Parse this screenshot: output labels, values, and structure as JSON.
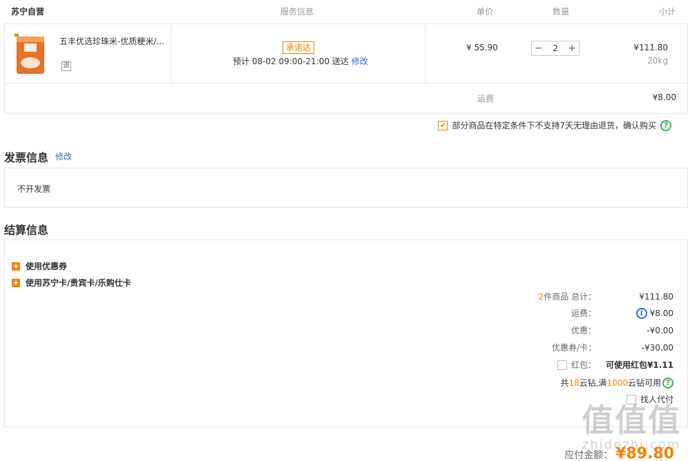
{
  "order_header": {
    "shop": "苏宁自营",
    "service": "服务信息",
    "unit_price": "单价",
    "quantity": "数量",
    "subtotal": "小计"
  },
  "item": {
    "name": "五丰优选珍珠米-优质粳米/...",
    "return_badge": "退",
    "promise_badge": "承诺达",
    "delivery_text": "预计 08-02 09:00-21:00 送达",
    "edit": "修改",
    "price": "¥ 55.90",
    "qty_minus": "−",
    "qty": "2",
    "qty_plus": "+",
    "subtotal": "¥111.80",
    "weight": "20kg"
  },
  "freight": {
    "label": "运费",
    "value": "¥8.00"
  },
  "agree": {
    "text": "部分商品在特定条件下不支持7天无理由退货，确认购买"
  },
  "invoice": {
    "title": "发票信息",
    "edit": "修改",
    "value": "不开发票"
  },
  "settlement": {
    "title": "结算信息",
    "options": [
      "使用优惠券",
      "使用苏宁卡/贵宾卡/乐购仕卡"
    ],
    "summary": {
      "items_count": "2",
      "items_label": "件商品 总计：",
      "items_total": "¥111.80",
      "freight_label": "运费：",
      "freight_value": "¥8.00",
      "discount_label": "优惠：",
      "discount_value": "-¥0.00",
      "coupon_label": "优惠券/卡：",
      "coupon_value": "-¥30.00",
      "redpack_label": "红包：",
      "redpack_value": "可使用红包¥1.11",
      "diamond_pre": "共 ",
      "diamond_have": "18",
      "diamond_mid": "云钻,满",
      "diamond_need": "1000",
      "diamond_post": "云钻可用",
      "proxy_pay": "找人代付"
    }
  },
  "total": {
    "label": "应付金额：",
    "value": "¥89.80"
  },
  "watermark": {
    "big": "值值值",
    "small": "zhidezhi.com"
  },
  "colors": {
    "accent": "#f08200",
    "link": "#2b71c6",
    "help": "#3bb54a"
  }
}
